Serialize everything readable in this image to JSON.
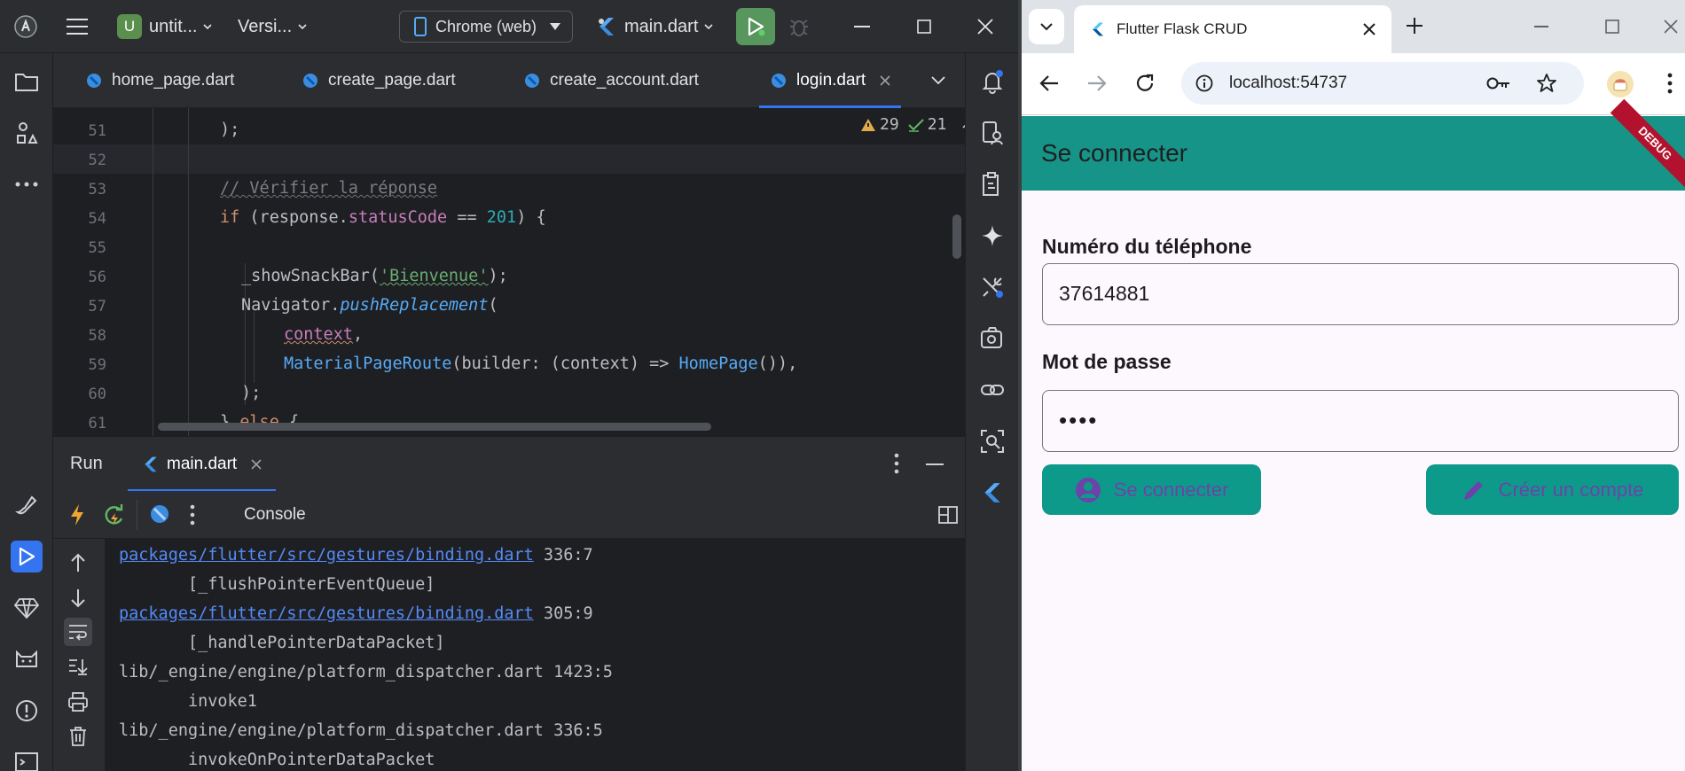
{
  "ide": {
    "project_badge": "U",
    "project_name": "untit...",
    "version_menu": "Versi...",
    "device": "Chrome (web)",
    "run_config": "main.dart",
    "tabs": [
      {
        "label": "home_page.dart"
      },
      {
        "label": "create_page.dart"
      },
      {
        "label": "create_account.dart"
      },
      {
        "label": "login.dart"
      }
    ],
    "inspection": {
      "warnings": "29",
      "checks": "21"
    },
    "code": {
      "line_numbers": [
        "51",
        "52",
        "53",
        "54",
        "55",
        "56",
        "57",
        "58",
        "59",
        "60",
        "61"
      ],
      "l51": ");",
      "l53": "// Vérifier la réponse",
      "l54_if": "if",
      "l54_a": " (response.",
      "l54_prop": "statusCode",
      "l54_b": " == ",
      "l54_num": "201",
      "l54_c": ") {",
      "l56_a": "_showSnackBar(",
      "l56_str": "'Bienvenue'",
      "l56_b": ");",
      "l57_a": "Navigator.",
      "l57_fn": "pushReplacement",
      "l57_b": "(",
      "l58_prop": "context",
      "l58_b": ",",
      "l59_cls": "MaterialPageRoute",
      "l59_a": "(builder: (context) => ",
      "l59_cls2": "HomePage",
      "l59_b": "()),",
      "l60": ");",
      "l61_a": "} ",
      "l61_kw": "else",
      "l61_b": " {"
    },
    "run_panel": {
      "title": "Run",
      "tab": "main.dart",
      "console_label": "Console",
      "lines": [
        {
          "link": "packages/flutter/src/gestures/binding.dart",
          "pos": " 336:7"
        },
        {
          "text": "       [_flushPointerEventQueue]"
        },
        {
          "link": "packages/flutter/src/gestures/binding.dart",
          "pos": " 305:9"
        },
        {
          "text": "       [_handlePointerDataPacket]"
        },
        {
          "text": "lib/_engine/engine/platform_dispatcher.dart 1423:5"
        },
        {
          "text": "       invoke1"
        },
        {
          "text": "lib/_engine/engine/platform_dispatcher.dart 336:5"
        },
        {
          "text": "       invokeOnPointerDataPacket"
        }
      ]
    }
  },
  "browser": {
    "tab_title": "Flutter Flask CRUD",
    "url": "localhost:54737",
    "app": {
      "title": "Se connecter",
      "debug_banner": "DEBUG",
      "phone_label": "Numéro du téléphone",
      "phone_value": "37614881",
      "password_label": "Mot de passe",
      "password_value": "••••",
      "login_button": "Se connecter",
      "create_button": "Créer un compte"
    }
  }
}
